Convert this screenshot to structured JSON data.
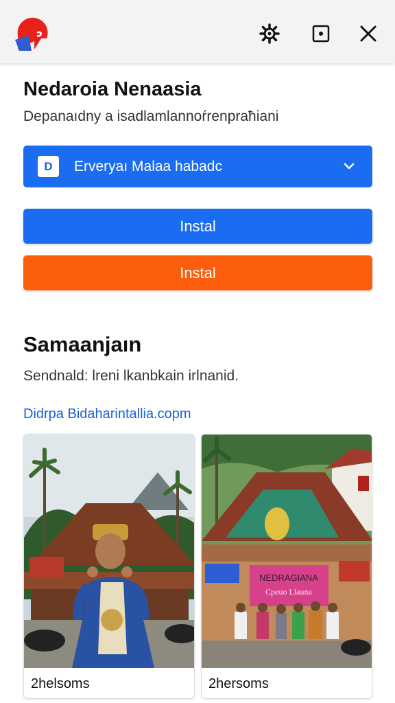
{
  "topbar": {
    "logo_icon": "app-logo-icon",
    "actions": [
      {
        "icon": "gear-icon"
      },
      {
        "icon": "square-frame-icon"
      },
      {
        "icon": "close-icon"
      }
    ]
  },
  "section1": {
    "title": "Nedaroia Nenaasia",
    "subtitle": "Depanaıdny a isadlamlannoŕrenpraħiani"
  },
  "select": {
    "badge": "D",
    "value": "Erveryaı Malaa habadc",
    "icon": "chevron-down-icon"
  },
  "buttons": {
    "primary_label": "Instal",
    "secondary_label": "Instal"
  },
  "section2": {
    "title": "Samaanjaın",
    "subtitle": "Sendnald: lreni lkanbkain irlnanid.",
    "link": "Didrpa Bidaharintallia.copm"
  },
  "cards": [
    {
      "label": "2helsoms",
      "image": "person-in-traditional-costume"
    },
    {
      "label": "2hersoms",
      "image": "group-at-traditional-house"
    }
  ],
  "banner_text": {
    "line1": "NEDRAGIANA",
    "line2": "Cpeuo Llauna"
  },
  "colors": {
    "primary": "#1a6df0",
    "secondary": "#fd5e0d",
    "link": "#1a62d6"
  }
}
